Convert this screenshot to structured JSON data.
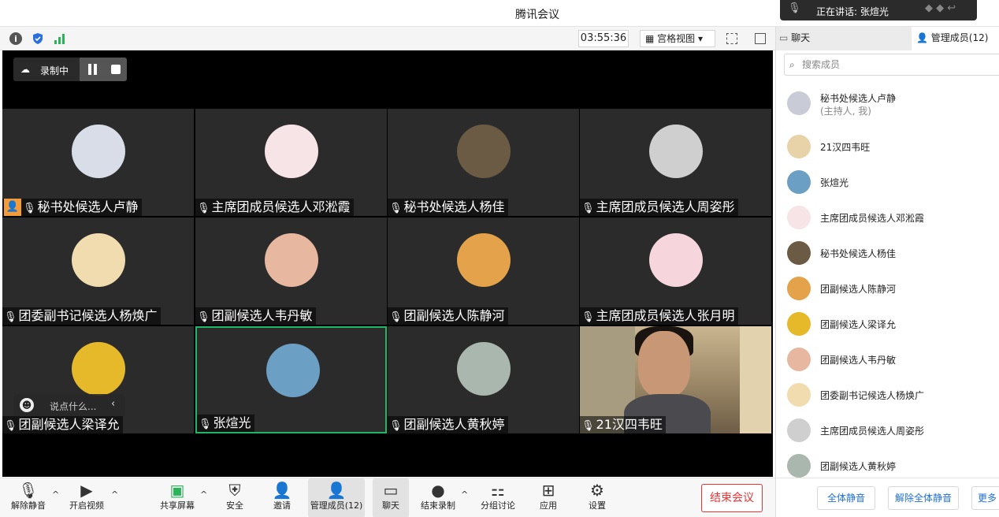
{
  "window": {
    "title": "腾讯会议"
  },
  "speaking": {
    "text": "正在讲话: 张煊光"
  },
  "toolbar": {
    "timer": "03:55:36",
    "view_label": "宫格视图 ▾"
  },
  "recording": {
    "label": "录制中"
  },
  "chat_input": {
    "placeholder": "说点什么..."
  },
  "tiles": [
    {
      "name": "秘书处候选人卢静",
      "avatar_color": "#d8dde8",
      "host": true
    },
    {
      "name": "主席团成员候选人邓淞霞",
      "avatar_color": "#f7e4e7"
    },
    {
      "name": "秘书处候选人杨佳",
      "avatar_color": "#6b5a44"
    },
    {
      "name": "主席团成员候选人周姿彤",
      "avatar_color": "#cfcfcf"
    },
    {
      "name": "团委副书记候选人杨焕广",
      "avatar_color": "#f0dcae"
    },
    {
      "name": "团副候选人韦丹敏",
      "avatar_color": "#e8b7a0"
    },
    {
      "name": "团副候选人陈静河",
      "avatar_color": "#e4a24a"
    },
    {
      "name": "主席团成员候选人张月明",
      "avatar_color": "#f6d6dc"
    },
    {
      "name": "团副候选人梁译允",
      "avatar_color": "#e6b92b"
    },
    {
      "name": "张煊光",
      "avatar_color": "#6c9fc4",
      "active": true
    },
    {
      "name": "团副候选人黄秋婷",
      "avatar_color": "#aab7ae"
    },
    {
      "name": "21汉四韦旺",
      "camera": true
    }
  ],
  "bottom": {
    "unmute": "解除静音",
    "video": "开启视频",
    "share": "共享屏幕",
    "security": "安全",
    "invite": "邀请",
    "members": "管理成员(12)",
    "chat": "聊天",
    "stop_record": "结束录制",
    "breakout": "分组讨论",
    "apps": "应用",
    "settings": "设置",
    "end": "结束会议"
  },
  "panel": {
    "tab_chat": "聊天",
    "tab_members": "管理成员(12)",
    "search_placeholder": "搜索成员",
    "members": [
      {
        "name": "秘书处候选人卢静",
        "role": "(主持人, 我)",
        "color": "#c9ccd6"
      },
      {
        "name": "21汉四韦旺",
        "color": "#e8d2a8"
      },
      {
        "name": "张煊光",
        "color": "#6c9fc4"
      },
      {
        "name": "主席团成员候选人邓淞霞",
        "color": "#f7e4e7"
      },
      {
        "name": "秘书处候选人杨佳",
        "color": "#6b5a44"
      },
      {
        "name": "团副候选人陈静河",
        "color": "#e4a24a"
      },
      {
        "name": "团副候选人梁译允",
        "color": "#e6b92b"
      },
      {
        "name": "团副候选人韦丹敏",
        "color": "#e8b7a0"
      },
      {
        "name": "团委副书记候选人杨焕广",
        "color": "#f0dcae"
      },
      {
        "name": "主席团成员候选人周姿彤",
        "color": "#cfcfcf"
      },
      {
        "name": "团副候选人黄秋婷",
        "color": "#aab7ae"
      }
    ],
    "btn_mute_all": "全体静音",
    "btn_unmute_all": "解除全体静音",
    "btn_more": "更多"
  }
}
